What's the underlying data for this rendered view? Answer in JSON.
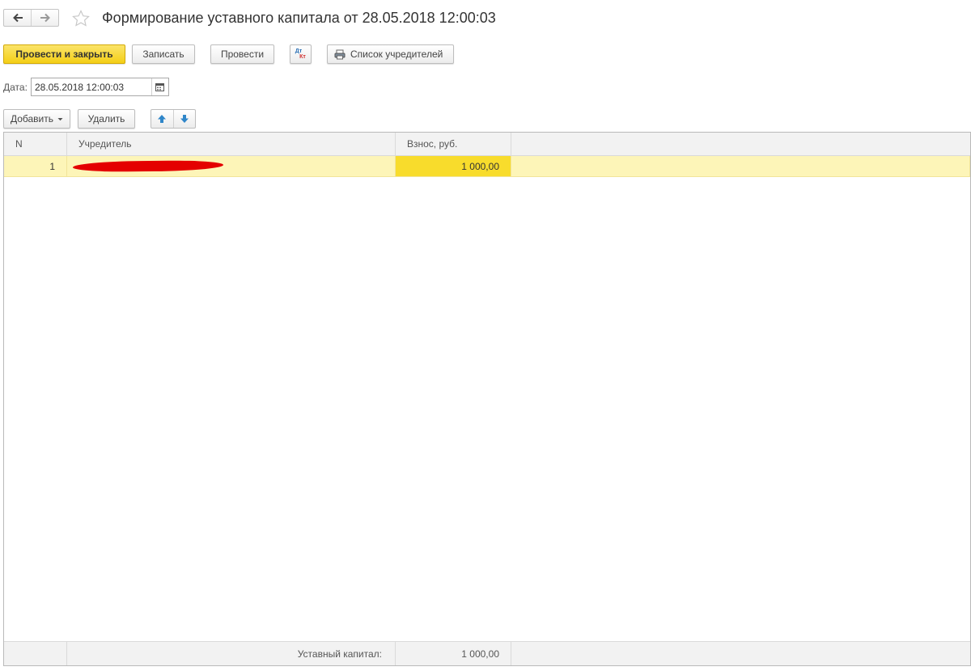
{
  "window": {
    "title": "Формирование уставного капитала от 28.05.2018 12:00:03"
  },
  "icons": {
    "back": "arrow-left-icon",
    "forward": "arrow-right-icon",
    "favorite": "star-icon",
    "dt_kt": "dt-kt-icon",
    "print": "printer-icon",
    "calendar": "calendar-icon",
    "move_up": "arrow-up-icon",
    "move_down": "arrow-down-icon"
  },
  "toolbar": {
    "post_and_close": "Провести и закрыть",
    "save": "Записать",
    "post": "Провести",
    "dt_label": "Дт",
    "kt_label": "Кт",
    "founders_list": "Список учредителей"
  },
  "date": {
    "label": "Дата:",
    "value": "28.05.2018 12:00:03"
  },
  "table_toolbar": {
    "add": "Добавить",
    "delete": "Удалить"
  },
  "table": {
    "columns": [
      "N",
      "Учредитель",
      "Взнос, руб."
    ],
    "rows": [
      {
        "n": "1",
        "founder": "",
        "amount": "1 000,00"
      }
    ],
    "footer": {
      "label": "Уставный капитал:",
      "total": "1 000,00"
    }
  },
  "colors": {
    "primary_button": "#f4cf16",
    "selected_row": "#fdf5b8",
    "selected_cell": "#f8dc2c",
    "redaction": "#e40000",
    "arrow_blue": "#2f86c9"
  }
}
